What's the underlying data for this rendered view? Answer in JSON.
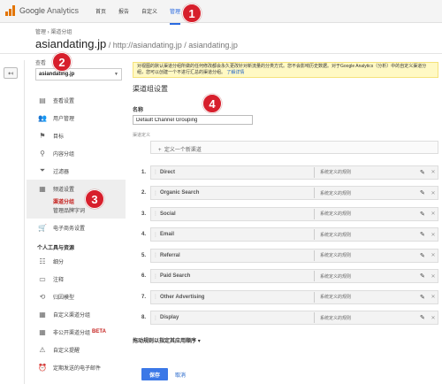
{
  "brand": {
    "name_a": "Google",
    "name_b": " Analytics",
    "color": "#e37400"
  },
  "topnav": [
    {
      "label": "首页",
      "active": false
    },
    {
      "label": "报告",
      "active": false
    },
    {
      "label": "自定义",
      "active": false
    },
    {
      "label": "管理",
      "active": true
    }
  ],
  "account": {
    "breadcrumb": "管理 › 渠道分组",
    "site": "asiandating.jp",
    "path": " / http://asiandating.jp / asiandating.jp"
  },
  "sidebar": {
    "view_label": "查看",
    "view_value": "asiandating.jp",
    "items": [
      {
        "label": "查看设置",
        "icon": "file-icon"
      },
      {
        "label": "用户管理",
        "icon": "users-icon"
      },
      {
        "label": "目标",
        "icon": "flag-icon"
      },
      {
        "label": "内容分组",
        "icon": "person-icon"
      },
      {
        "label": "过滤器",
        "icon": "filter-icon"
      }
    ],
    "channel_group": {
      "label": "频道设置",
      "icon": "grid-icon",
      "subs": [
        "渠道分组",
        "管理品牌字词"
      ]
    },
    "ecommerce": {
      "label": "电子商务设置",
      "icon": "cart-icon"
    },
    "personal_section": "个人工具与资源",
    "personal_items": [
      {
        "label": "细分",
        "icon": "segment-icon"
      },
      {
        "label": "注释",
        "icon": "comment-icon"
      },
      {
        "label": "归因模型",
        "icon": "attribution-icon"
      },
      {
        "label": "自定义渠道分组",
        "icon": "channel-icon"
      },
      {
        "label": "非公开渠道分组",
        "icon": "private-channel-icon",
        "badge": "BETA"
      },
      {
        "label": "自定义提醒",
        "icon": "alert-icon"
      },
      {
        "label": "定期发送的电子邮件",
        "icon": "clock-icon"
      }
    ]
  },
  "notice": {
    "text": "对视图的默认渠道分组所做的任何修改都会永久更改针对新流量的分类方式。您不会影响历史数据。对于Google Analytics（分析）中的自定义渠道分组，您可以创建一个不进行汇总的渠道分组。",
    "link": "了解详情"
  },
  "form": {
    "title": "渠道组设置",
    "name_label": "名称",
    "name_value": "Default Channel Grouping",
    "definition_label": "渠道定义",
    "add_rule": "定义一个新渠道",
    "reorder": "拖动规则以指定其应用顺序",
    "save": "保存",
    "cancel": "取消"
  },
  "channels": [
    {
      "num": "1.",
      "name": "Direct",
      "rule": "系统定义的规则"
    },
    {
      "num": "2.",
      "name": "Organic Search",
      "rule": "系统定义的规则"
    },
    {
      "num": "3.",
      "name": "Social",
      "rule": "系统定义的规则"
    },
    {
      "num": "4.",
      "name": "Email",
      "rule": "系统定义的规则"
    },
    {
      "num": "5.",
      "name": "Referral",
      "rule": "系统定义的规则"
    },
    {
      "num": "6.",
      "name": "Paid Search",
      "rule": "系统定义的规则"
    },
    {
      "num": "7.",
      "name": "Other Advertising",
      "rule": "系统定义的规则"
    },
    {
      "num": "8.",
      "name": "Display",
      "rule": "系统定义的规则"
    }
  ],
  "badges": [
    "1",
    "2",
    "3",
    "4"
  ],
  "colors": {
    "accent": "#2a6ae0",
    "callout": "#d71f2c",
    "notice_bg": "#fff9c4",
    "save": "#3b78e7"
  }
}
